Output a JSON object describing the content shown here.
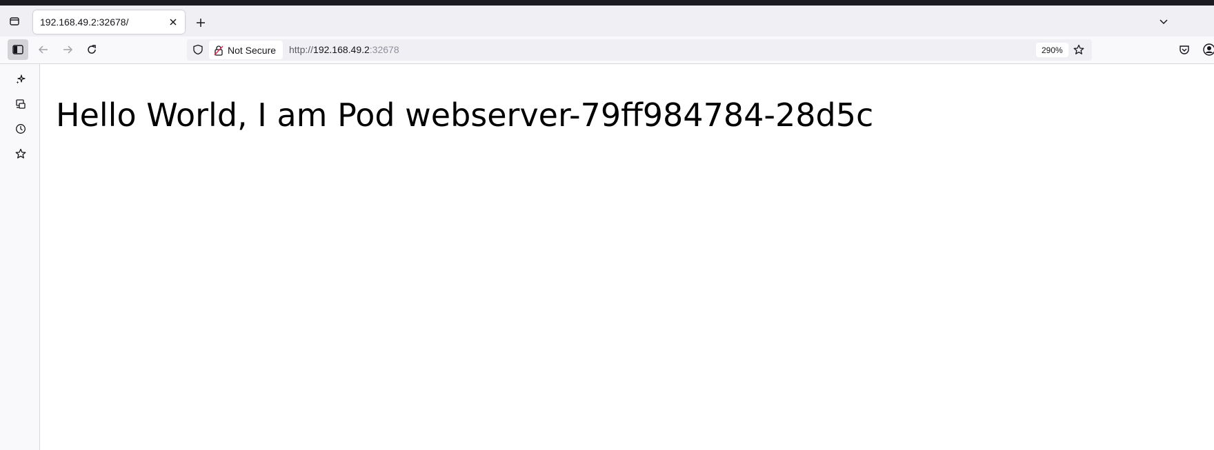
{
  "tab": {
    "title": "192.168.49.2:32678/",
    "close_icon": "close-icon"
  },
  "toolbar": {
    "security_label": "Not Secure",
    "url_scheme": "http://",
    "url_host": "192.168.49.2",
    "url_port": ":32678",
    "zoom": "290%"
  },
  "sidebar": {
    "items": [
      {
        "icon": "ai-chatbot-icon"
      },
      {
        "icon": "synced-tabs-icon"
      },
      {
        "icon": "history-icon"
      },
      {
        "icon": "bookmarks-icon"
      }
    ]
  },
  "page": {
    "heading": "Hello World, I am Pod webserver-79ff984784-28d5c"
  },
  "colors": {
    "tab_strip": "#f0f0f4",
    "toolbar": "#f9f9fb",
    "insecure_lock": "#e22850",
    "os_bar": "#1c1b22"
  }
}
